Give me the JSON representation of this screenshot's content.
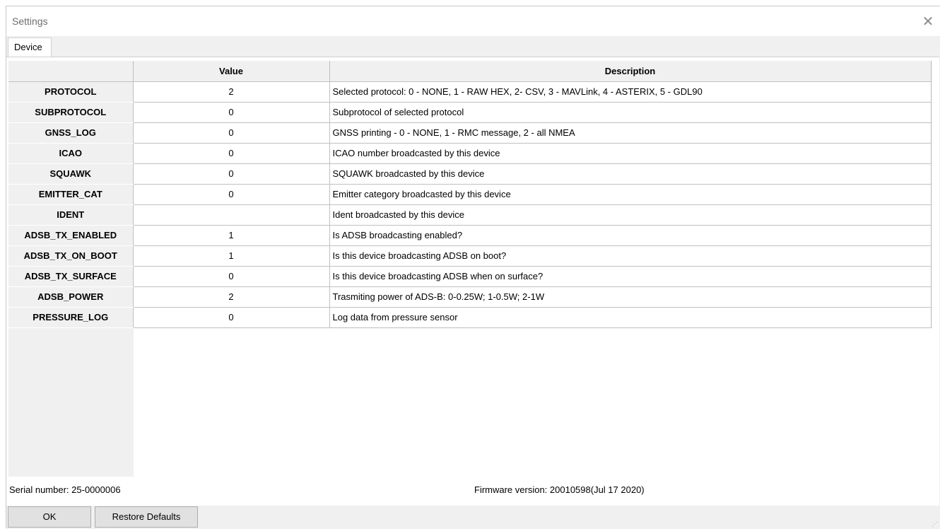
{
  "window": {
    "title": "Settings",
    "close_icon": "close-icon"
  },
  "tabs": [
    {
      "label": "Device",
      "active": true
    }
  ],
  "table": {
    "columns": [
      "",
      "Value",
      "Description"
    ],
    "rows": [
      {
        "name": "PROTOCOL",
        "value": "2",
        "description": "Selected protocol: 0 - NONE, 1 - RAW HEX, 2- CSV, 3 - MAVLink, 4 - ASTERIX, 5 - GDL90"
      },
      {
        "name": "SUBPROTOCOL",
        "value": "0",
        "description": "Subprotocol of selected protocol"
      },
      {
        "name": "GNSS_LOG",
        "value": "0",
        "description": "GNSS printing - 0 - NONE, 1 - RMC message, 2 - all NMEA"
      },
      {
        "name": "ICAO",
        "value": "0",
        "description": "ICAO number broadcasted by this device"
      },
      {
        "name": "SQUAWK",
        "value": "0",
        "description": "SQUAWK broadcasted by this device"
      },
      {
        "name": "EMITTER_CAT",
        "value": "0",
        "description": "Emitter category broadcasted by this device"
      },
      {
        "name": "IDENT",
        "value": "",
        "description": "Ident broadcasted by this device"
      },
      {
        "name": "ADSB_TX_ENABLED",
        "value": "1",
        "description": "Is ADSB broadcasting enabled?"
      },
      {
        "name": "ADSB_TX_ON_BOOT",
        "value": "1",
        "description": "Is this device broadcasting ADSB on boot?"
      },
      {
        "name": "ADSB_TX_SURFACE",
        "value": "0",
        "description": "Is this device broadcasting ADSB when on surface?"
      },
      {
        "name": "ADSB_POWER",
        "value": "2",
        "description": "Trasmiting power of ADS-B: 0-0.25W; 1-0.5W; 2-1W"
      },
      {
        "name": "PRESSURE_LOG",
        "value": "0",
        "description": "Log data from pressure sensor"
      }
    ]
  },
  "footer": {
    "serial": "Serial number: 25-0000006",
    "firmware": "Firmware version: 20010598(Jul 17 2020)"
  },
  "buttons": {
    "ok": "OK",
    "restore": "Restore Defaults"
  }
}
